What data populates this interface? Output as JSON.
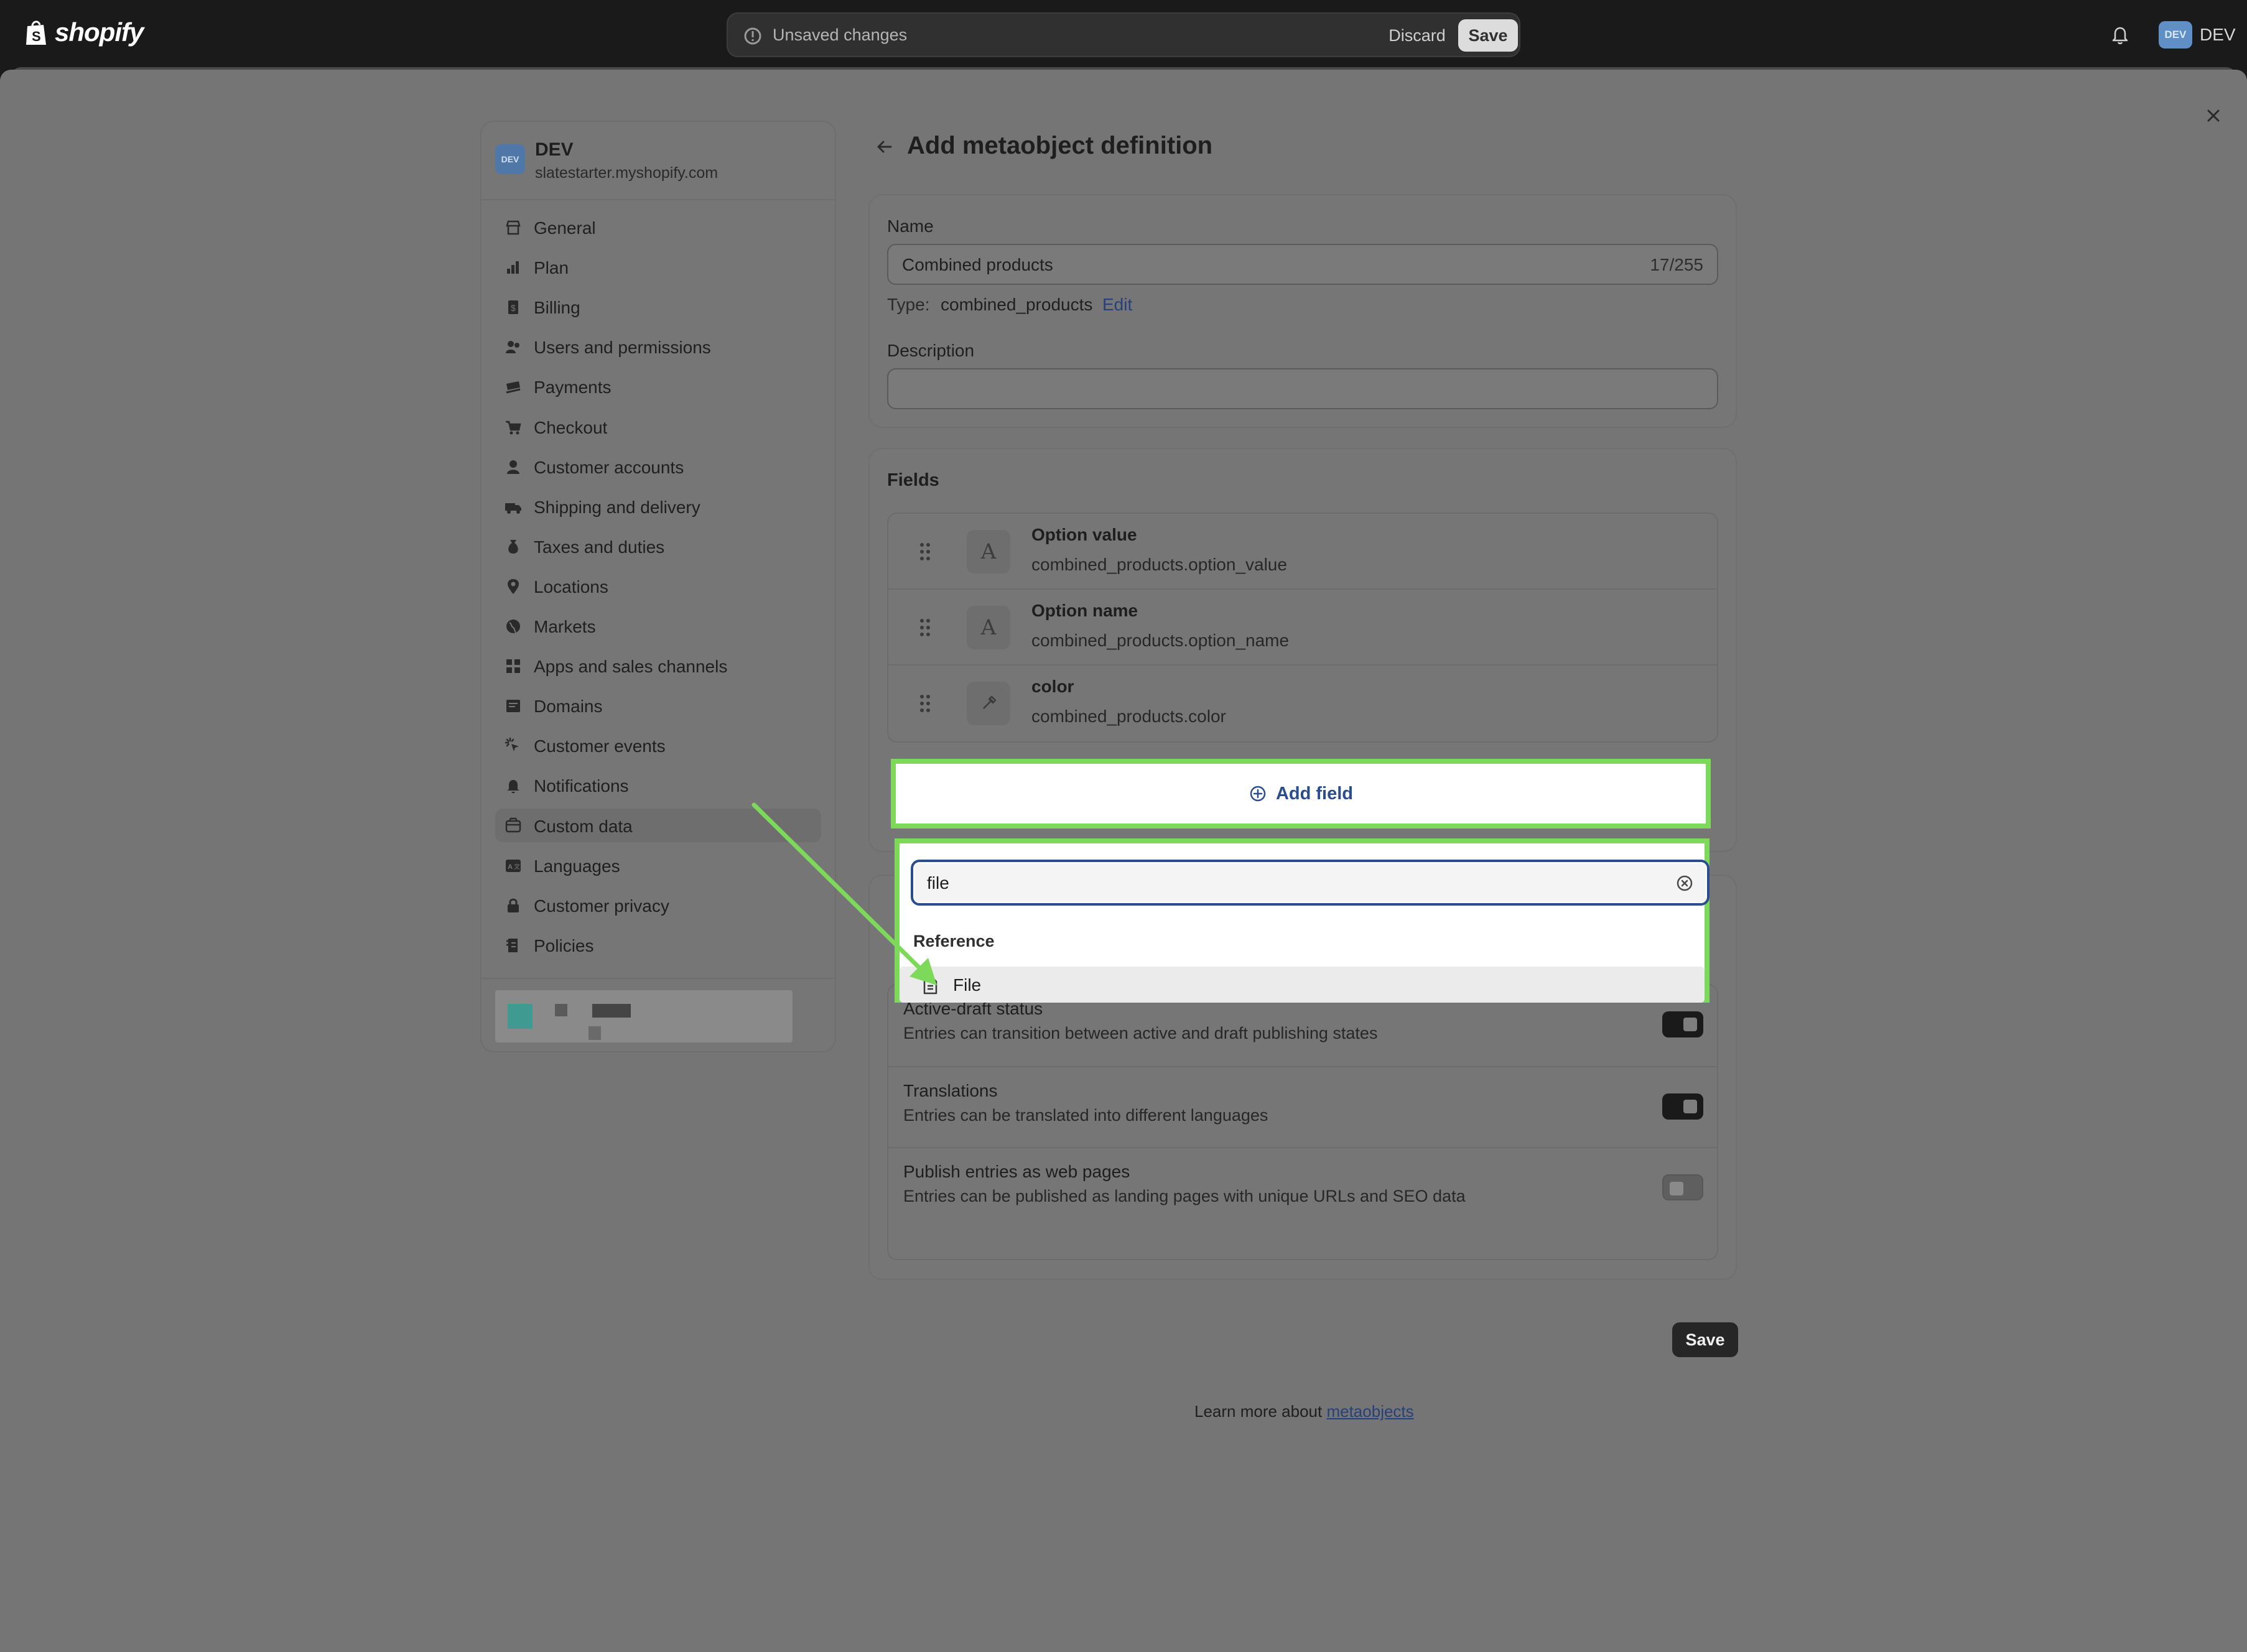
{
  "topbar": {
    "logo_text": "shopify",
    "unsaved_text": "Unsaved changes",
    "discard_label": "Discard",
    "save_label": "Save",
    "avatar_initials": "DEV",
    "avatar_name": "DEV"
  },
  "sidebar": {
    "store_badge": "DEV",
    "store_name": "DEV",
    "store_url": "slatestarter.myshopify.com",
    "items": [
      {
        "label": "General",
        "icon": "store-icon"
      },
      {
        "label": "Plan",
        "icon": "plan-icon"
      },
      {
        "label": "Billing",
        "icon": "billing-icon"
      },
      {
        "label": "Users and permissions",
        "icon": "users-icon"
      },
      {
        "label": "Payments",
        "icon": "payments-icon"
      },
      {
        "label": "Checkout",
        "icon": "cart-icon"
      },
      {
        "label": "Customer accounts",
        "icon": "person-icon"
      },
      {
        "label": "Shipping and delivery",
        "icon": "truck-icon"
      },
      {
        "label": "Taxes and duties",
        "icon": "tax-icon"
      },
      {
        "label": "Locations",
        "icon": "location-icon"
      },
      {
        "label": "Markets",
        "icon": "globe-icon"
      },
      {
        "label": "Apps and sales channels",
        "icon": "apps-icon"
      },
      {
        "label": "Domains",
        "icon": "domains-icon"
      },
      {
        "label": "Customer events",
        "icon": "cursor-icon"
      },
      {
        "label": "Notifications",
        "icon": "bell-icon"
      },
      {
        "label": "Custom data",
        "icon": "custom-data-icon",
        "active": true
      },
      {
        "label": "Languages",
        "icon": "language-icon"
      },
      {
        "label": "Customer privacy",
        "icon": "lock-icon"
      },
      {
        "label": "Policies",
        "icon": "policies-icon"
      }
    ]
  },
  "main": {
    "title": "Add metaobject definition",
    "name_card": {
      "name_label": "Name",
      "name_value": "Combined products",
      "name_count": "17/255",
      "type_label": "Type:",
      "type_value": "combined_products",
      "edit_label": "Edit",
      "description_label": "Description",
      "description_value": ""
    },
    "fields_card": {
      "heading": "Fields",
      "fields": [
        {
          "name": "Option value",
          "key": "combined_products.option_value",
          "type_icon": "text-icon"
        },
        {
          "name": "Option name",
          "key": "combined_products.option_name",
          "type_icon": "text-icon"
        },
        {
          "name": "color",
          "key": "combined_products.color",
          "type_icon": "eyedropper-icon"
        }
      ],
      "add_field_label": "Add field"
    },
    "popover": {
      "search_value": "file",
      "group_heading": "Reference",
      "option_label": "File"
    },
    "options": [
      {
        "title": "Active-draft status",
        "description": "Entries can transition between active and draft publishing states",
        "enabled": true
      },
      {
        "title": "Translations",
        "description": "Entries can be translated into different languages",
        "enabled": true
      },
      {
        "title": "Publish entries as web pages",
        "description": "Entries can be published as landing pages with unique URLs and SEO data",
        "enabled": false
      }
    ],
    "save_label": "Save",
    "learn_more_prefix": "Learn more about ",
    "learn_more_link": "metaobjects"
  },
  "colors": {
    "highlight": "#7dd95a",
    "focus": "#2a4d8f",
    "link": "#2a4d8f"
  }
}
